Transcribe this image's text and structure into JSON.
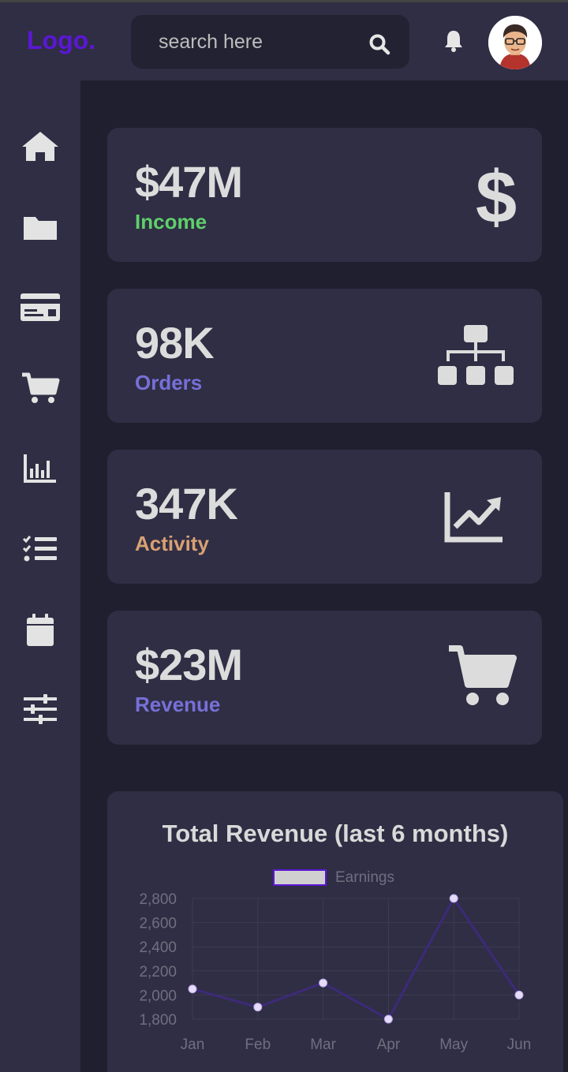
{
  "header": {
    "logo": "Logo.",
    "search_placeholder": "search here"
  },
  "sidebar": {
    "items": [
      {
        "icon": "home-icon"
      },
      {
        "icon": "folder-icon"
      },
      {
        "icon": "credit-card-icon"
      },
      {
        "icon": "cart-icon"
      },
      {
        "icon": "bar-chart-icon"
      },
      {
        "icon": "checklist-icon"
      },
      {
        "icon": "calendar-icon"
      },
      {
        "icon": "sliders-icon"
      }
    ]
  },
  "cards": [
    {
      "value": "$47M",
      "label": "Income",
      "label_color": "#5fcf6a",
      "icon": "dollar-icon"
    },
    {
      "value": "98K",
      "label": "Orders",
      "label_color": "#7770d8",
      "icon": "sitemap-icon"
    },
    {
      "value": "347K",
      "label": "Activity",
      "label_color": "#d9a073",
      "icon": "trend-chart-icon"
    },
    {
      "value": "$23M",
      "label": "Revenue",
      "label_color": "#7770d8",
      "icon": "cart-icon"
    }
  ],
  "colors": {
    "accent": "#5b17d6",
    "line": "#3d2a7a",
    "point": "#e6dcf7"
  },
  "chart_data": {
    "type": "line",
    "title": "Total Revenue (last 6 months)",
    "categories": [
      "Jan",
      "Feb",
      "Mar",
      "Apr",
      "May",
      "Jun"
    ],
    "series": [
      {
        "name": "Earnings",
        "values": [
          2050,
          1900,
          2100,
          1800,
          2800,
          2000
        ]
      }
    ],
    "y_ticks": [
      "2,800",
      "2,600",
      "2,400",
      "2,200",
      "2,000",
      "1,800"
    ],
    "ylim": [
      1800,
      2800
    ],
    "grid": true,
    "legend": "top-center"
  }
}
